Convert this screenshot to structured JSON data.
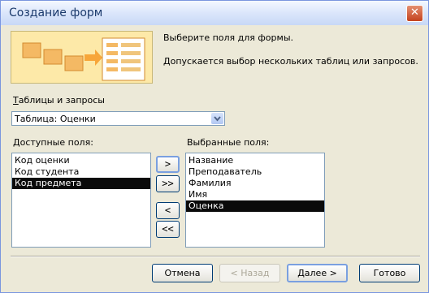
{
  "window": {
    "title": "Создание форм",
    "close_symbol": "✕"
  },
  "banner": {
    "line1": "Выберите поля для формы.",
    "line2": "Допускается выбор нескольких таблиц или запросов."
  },
  "tables": {
    "label_underlined": "Т",
    "label_rest": "аблицы и запросы",
    "selected": "Таблица: Оценки"
  },
  "available": {
    "label_underlined": "Д",
    "label_rest": "оступные поля:",
    "items": [
      "Код оценки",
      "Код студента",
      "Код предмета"
    ],
    "highlighted_index": 2
  },
  "selected": {
    "label": "Выбранные поля:",
    "items": [
      "Название",
      "Преподаватель",
      "Фамилия",
      "Имя",
      "Оценка"
    ],
    "highlighted_index": 4
  },
  "move_buttons": {
    "add": ">",
    "add_all": ">>",
    "remove": "<",
    "remove_all": "<<"
  },
  "footer": {
    "cancel": "Отмена",
    "back": "< Назад",
    "next": "Далее >",
    "finish": "Готово"
  },
  "colors": {
    "title_text": "#1b3a6c",
    "selection_bg": "#0a0a0a",
    "dialog_bg": "#ece9d8"
  }
}
